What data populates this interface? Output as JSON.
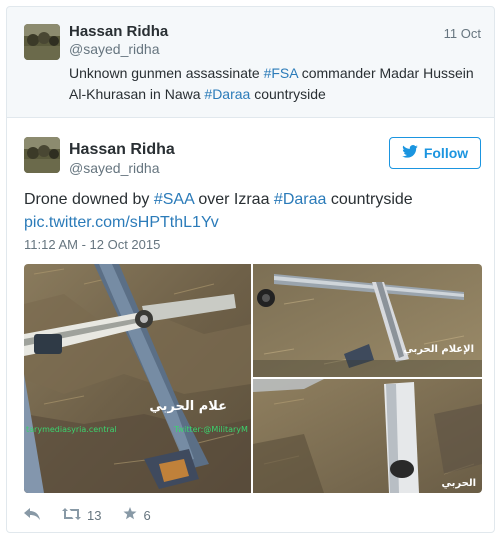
{
  "tweet1": {
    "name": "Hassan Ridha",
    "handle": "@sayed_ridha",
    "date": "11 Oct",
    "text": {
      "p1": "Unknown gunmen assassinate ",
      "hashtag1": "#FSA",
      "p2": " commander Madar Hussein Al-Khurasan in Nawa ",
      "hashtag2": "#Daraa",
      "p3": " countryside"
    }
  },
  "tweet2": {
    "name": "Hassan Ridha",
    "handle": "@sayed_ridha",
    "follow_label": "Follow",
    "text": {
      "p1": "Drone downed by ",
      "hashtag1": "#SAA",
      "p2": " over Izraa ",
      "hashtag2": "#Daraa",
      "p3": " countryside",
      "link": "pic.twitter.com/sHPTthL1Yv"
    },
    "timestamp": "11:12 AM - 12 Oct 2015",
    "media": {
      "watermark_arabic": "علام الحربي",
      "watermark_site": "tarymediasyria.central",
      "watermark_handle": "Twitter:@MilitaryM",
      "tr_arabic": "الإعلام الحربي",
      "br_arabic": "الحربي"
    },
    "retweet_count": "13",
    "favorite_count": "6"
  },
  "colors": {
    "link": "#2b7bb9",
    "follow": "#1b95e0",
    "muted": "#66757f"
  },
  "icons": [
    "reply-icon",
    "retweet-icon",
    "favorite-icon",
    "twitter-bird-icon"
  ]
}
